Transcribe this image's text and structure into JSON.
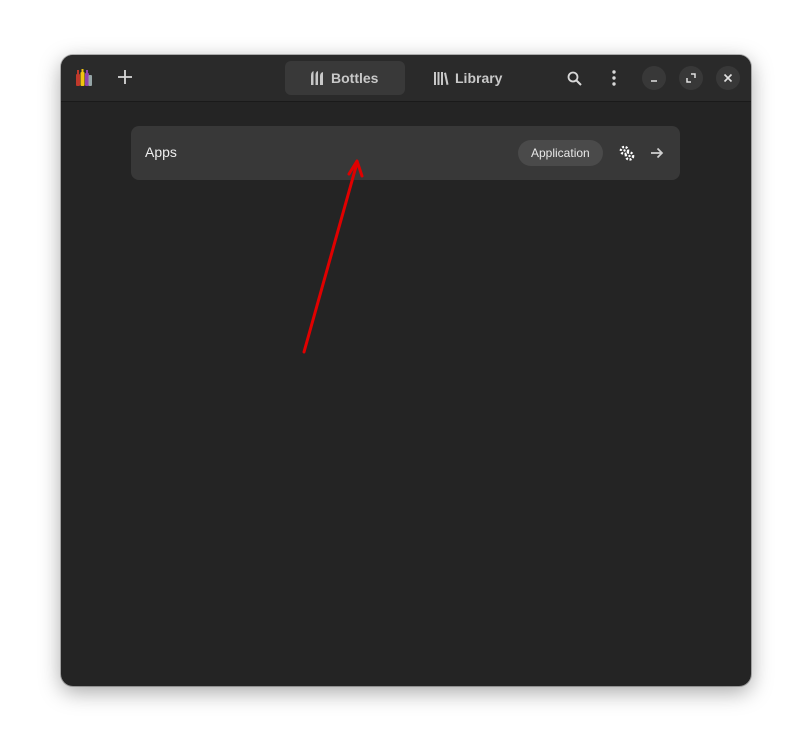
{
  "window": {
    "header": {
      "tabs": [
        {
          "label": "Bottles",
          "icon": "bottles-icon",
          "active": true
        },
        {
          "label": "Library",
          "icon": "library-icon",
          "active": false
        }
      ],
      "icons": {
        "app": "bottles-app-icon",
        "add": "plus-icon",
        "search": "search-icon",
        "menu": "kebab-menu-icon",
        "minimize": "minimize-icon",
        "maximize": "maximize-icon",
        "close": "close-icon"
      }
    },
    "bottles": [
      {
        "name": "Apps",
        "environment": "Application",
        "run_icon": "run-executable-icon",
        "open_icon": "arrow-right-icon"
      }
    ]
  },
  "colors": {
    "window_bg": "#242424",
    "header_bg": "#2a2a2a",
    "row_bg": "#383838",
    "badge_bg": "#4a4a4a",
    "annotation_arrow": "#e00000"
  }
}
